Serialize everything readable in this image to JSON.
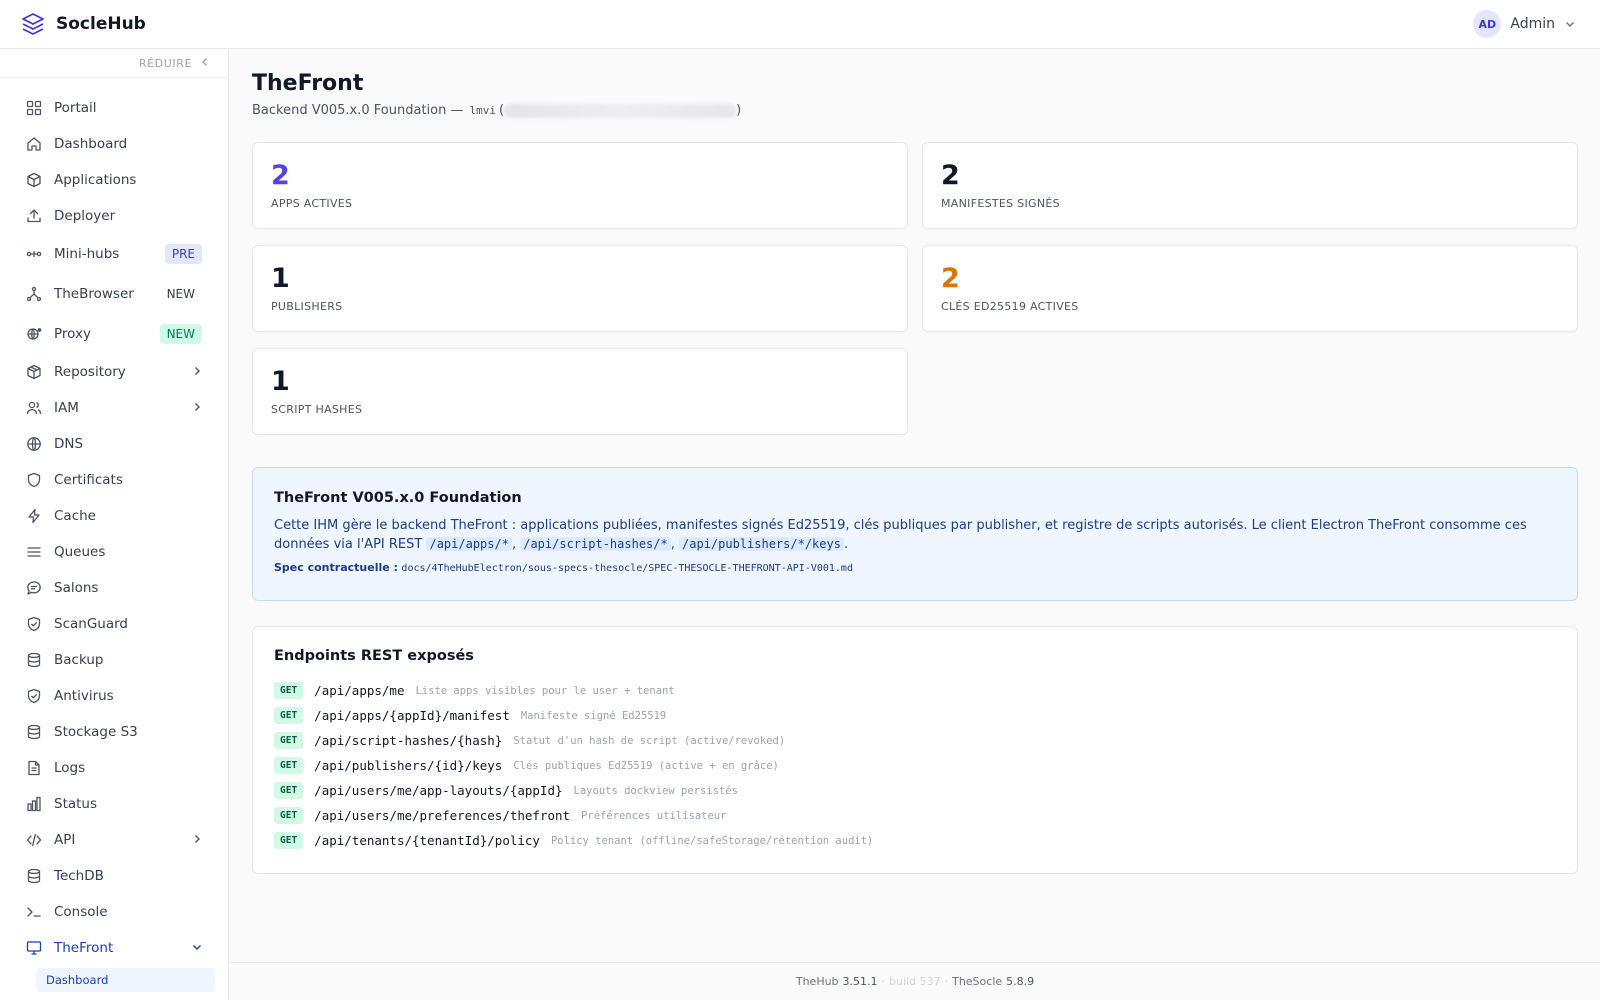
{
  "header": {
    "brand": "SocleHub",
    "user_initials": "AD",
    "user_name": "Admin"
  },
  "sidebar": {
    "collapse_label": "RÉDUIRE",
    "items": [
      {
        "label": "Portail",
        "icon": "grid-icon"
      },
      {
        "label": "Dashboard",
        "icon": "home-icon"
      },
      {
        "label": "Applications",
        "icon": "box-icon"
      },
      {
        "label": "Deployer",
        "icon": "upload-icon"
      },
      {
        "label": "Mini-hubs",
        "icon": "hub-icon",
        "badge": "PRE"
      },
      {
        "label": "TheBrowser",
        "icon": "branch-icon",
        "badge": "NEW"
      },
      {
        "label": "Proxy",
        "icon": "proxy-icon",
        "badge": "NEW"
      },
      {
        "label": "Repository",
        "icon": "package-icon"
      },
      {
        "label": "IAM",
        "icon": "users-icon"
      },
      {
        "label": "DNS",
        "icon": "globe-icon"
      },
      {
        "label": "Certificats",
        "icon": "shield-icon"
      },
      {
        "label": "Cache",
        "icon": "bolt-icon"
      },
      {
        "label": "Queues",
        "icon": "list-icon"
      },
      {
        "label": "Salons",
        "icon": "chat-icon"
      },
      {
        "label": "ScanGuard",
        "icon": "shield-check-icon"
      },
      {
        "label": "Backup",
        "icon": "database-icon"
      },
      {
        "label": "Antivirus",
        "icon": "shield-check-icon"
      },
      {
        "label": "Stockage S3",
        "icon": "database-icon"
      },
      {
        "label": "Logs",
        "icon": "file-icon"
      },
      {
        "label": "Status",
        "icon": "bar-chart-icon"
      },
      {
        "label": "API",
        "icon": "code-icon"
      },
      {
        "label": "TechDB",
        "icon": "database-icon"
      },
      {
        "label": "Console",
        "icon": "terminal-icon"
      },
      {
        "label": "TheFront",
        "icon": "monitor-icon"
      }
    ],
    "sub_active": "Dashboard"
  },
  "main": {
    "title": "TheFront",
    "subtitle_prefix": "Backend V005.x.0 Foundation —",
    "subtitle_code": "lmvi",
    "subtitle_open": "(",
    "subtitle_close": ")",
    "stats": [
      {
        "value": "2",
        "label": "APPS ACTIVES",
        "color": "#4f46e5"
      },
      {
        "value": "2",
        "label": "MANIFESTES SIGNÉS",
        "color": "#111827"
      },
      {
        "value": "1",
        "label": "PUBLISHERS",
        "color": "#111827"
      },
      {
        "value": "2",
        "label": "CLÉS ED25519 ACTIVES",
        "color": "#d97706"
      },
      {
        "value": "1",
        "label": "SCRIPT HASHES",
        "color": "#111827"
      }
    ],
    "info": {
      "title": "TheFront V005.x.0 Foundation",
      "text_1": "Cette IHM gère le backend TheFront : applications publiées, manifestes signés Ed25519, clés publiques par publisher, et registre de scripts autorisés. Le client Electron TheFront consomme ces données via l'API REST",
      "code_1": "/api/apps/*",
      "sep_1": ",",
      "code_2": "/api/script-hashes/*",
      "sep_2": ",",
      "code_3": "/api/publishers/*/keys",
      "end": ".",
      "spec_label": "Spec contractuelle :",
      "spec_path": "docs/4TheHubElectron/sous-specs-thesocle/SPEC-THESOCLE-THEFRONT-API-V001.md"
    },
    "endpoints": {
      "title": "Endpoints REST exposés",
      "rows": [
        {
          "method": "GET",
          "path": "/api/apps/me",
          "desc": "Liste apps visibles pour le user + tenant"
        },
        {
          "method": "GET",
          "path": "/api/apps/{appId}/manifest",
          "desc": "Manifeste signé Ed25519"
        },
        {
          "method": "GET",
          "path": "/api/script-hashes/{hash}",
          "desc": "Statut d'un hash de script (active/revoked)"
        },
        {
          "method": "GET",
          "path": "/api/publishers/{id}/keys",
          "desc": "Clés publiques Ed25519 (active + en grâce)"
        },
        {
          "method": "GET",
          "path": "/api/users/me/app-layouts/{appId}",
          "desc": "Layouts dockview persistés"
        },
        {
          "method": "GET",
          "path": "/api/users/me/preferences/thefront",
          "desc": "Préférences utilisateur"
        },
        {
          "method": "GET",
          "path": "/api/tenants/{tenantId}/policy",
          "desc": "Policy tenant (offline/safeStorage/rétention audit)"
        }
      ]
    }
  },
  "footer": {
    "hub_label": "TheHub",
    "hub_version": "3.51.1",
    "build": "build 537",
    "socle_label": "TheSocle",
    "socle_version": "5.8.9",
    "dot": "·"
  },
  "colors": {
    "accent": "#4f46e5",
    "warning": "#d97706",
    "link": "#1e40af"
  }
}
